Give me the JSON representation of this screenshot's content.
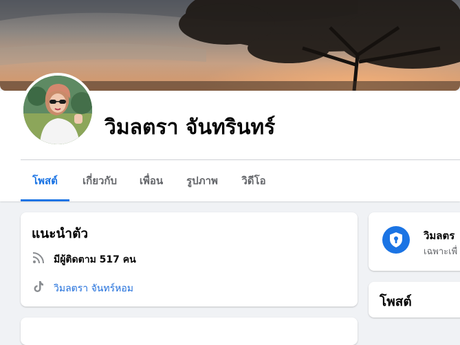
{
  "profile": {
    "name": "วิมลตรา จันทรินทร์"
  },
  "tabs": [
    {
      "label": "โพสต์",
      "active": true
    },
    {
      "label": "เกี่ยวกับ",
      "active": false
    },
    {
      "label": "เพื่อน",
      "active": false
    },
    {
      "label": "รูปภาพ",
      "active": false
    },
    {
      "label": "วิดีโอ",
      "active": false
    }
  ],
  "intro": {
    "title": "แนะนำตัว",
    "followers_text": "มีผู้ติดตาม 517 คน",
    "tiktok_link": "วิมลตรา จันทร์หอม",
    "followers_icon": "rss-icon",
    "tiktok_icon": "tiktok-icon"
  },
  "privacy": {
    "title": "วิมลตร",
    "subtitle": "เฉพาะเพื่",
    "icon": "shield-lock-icon"
  },
  "posts": {
    "title": "โพสต์"
  },
  "colors": {
    "accent": "#1b74e4",
    "link": "#216fdb",
    "background": "#f0f2f5",
    "secondary_text": "#65676b"
  }
}
